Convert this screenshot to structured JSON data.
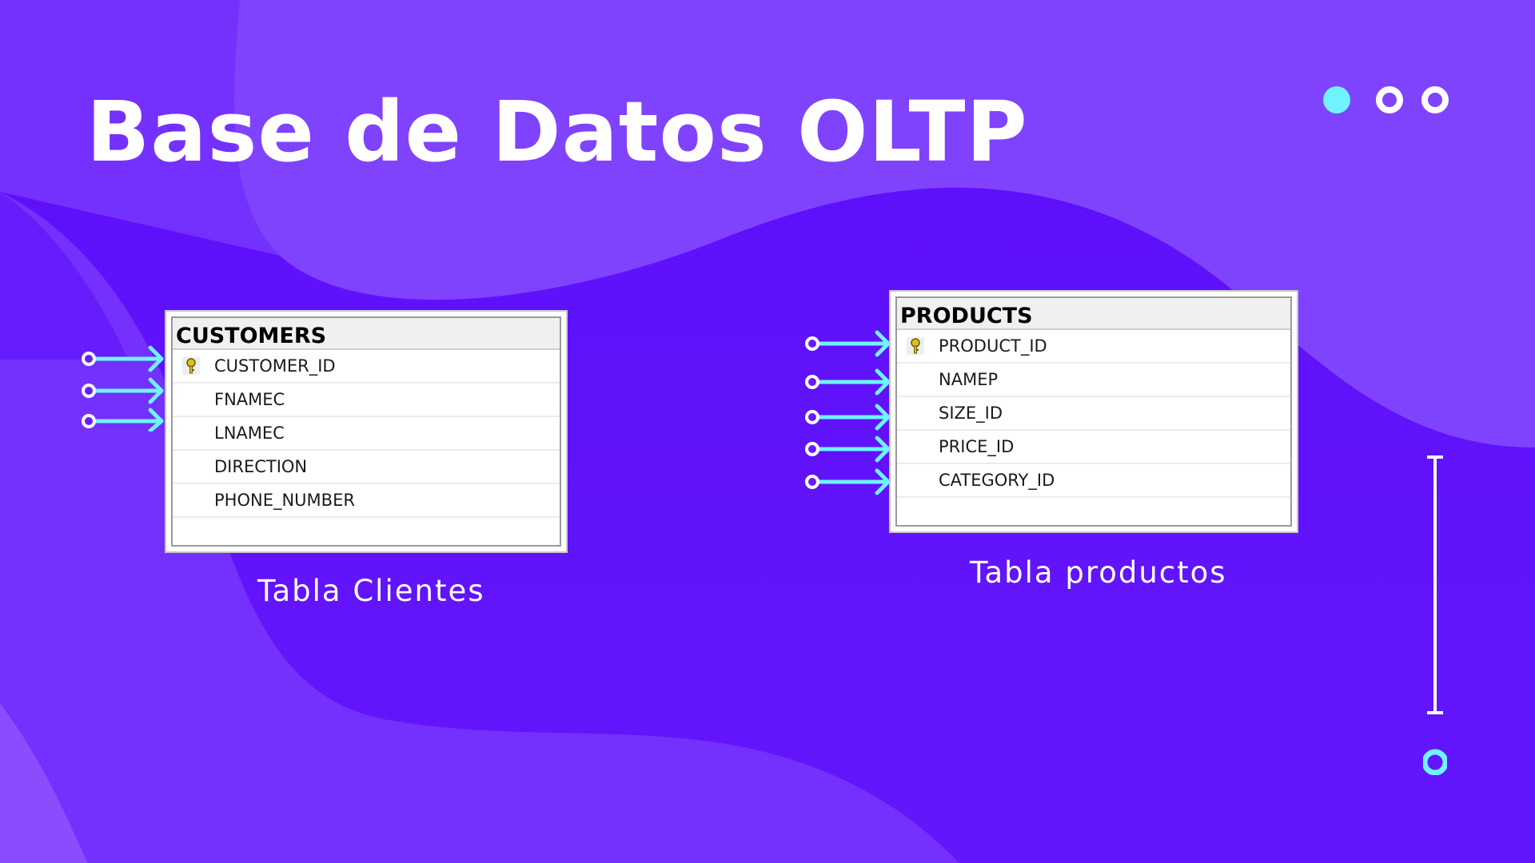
{
  "slide": {
    "title": "Base de Datos OLTP",
    "colors": {
      "background": "#6a1bfa",
      "accent": "#6ff3ff",
      "text": "#ffffff"
    }
  },
  "decorations": {
    "top_dots": [
      "filled-dot",
      "ring-dot",
      "ring-dot"
    ],
    "bottom_ring": "ring-dot"
  },
  "customers": {
    "table_name": "CUSTOMERS",
    "columns": [
      {
        "name": "CUSTOMER_ID",
        "primary_key": true
      },
      {
        "name": "FNAMEC",
        "primary_key": false
      },
      {
        "name": "LNAMEC",
        "primary_key": false
      },
      {
        "name": "DIRECTION",
        "primary_key": false
      },
      {
        "name": "PHONE_NUMBER",
        "primary_key": false
      }
    ],
    "caption": "Tabla Clientes"
  },
  "products": {
    "table_name": "PRODUCTS",
    "columns": [
      {
        "name": "PRODUCT_ID",
        "primary_key": true
      },
      {
        "name": "NAMEP",
        "primary_key": false
      },
      {
        "name": "SIZE_ID",
        "primary_key": false
      },
      {
        "name": "PRICE_ID",
        "primary_key": false
      },
      {
        "name": "CATEGORY_ID",
        "primary_key": false
      }
    ],
    "caption": "Tabla productos"
  }
}
